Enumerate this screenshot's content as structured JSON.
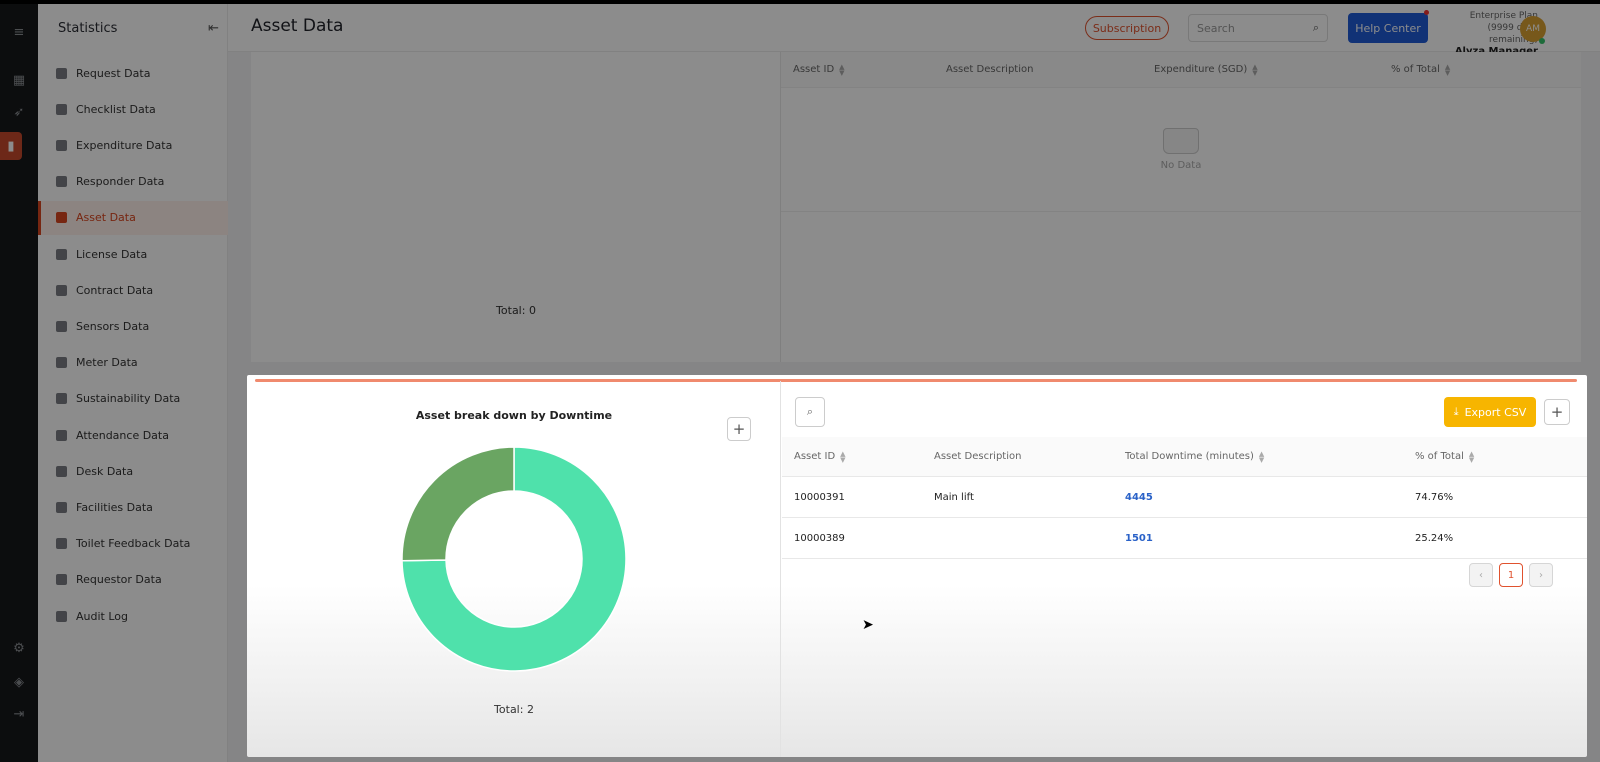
{
  "sidebar": {
    "title": "Statistics",
    "items": [
      {
        "label": "Request Data"
      },
      {
        "label": "Checklist Data"
      },
      {
        "label": "Expenditure Data"
      },
      {
        "label": "Responder Data"
      },
      {
        "label": "Asset Data"
      },
      {
        "label": "License Data"
      },
      {
        "label": "Contract Data"
      },
      {
        "label": "Sensors Data"
      },
      {
        "label": "Meter Data"
      },
      {
        "label": "Sustainability Data"
      },
      {
        "label": "Attendance Data"
      },
      {
        "label": "Desk Data"
      },
      {
        "label": "Facilities Data"
      },
      {
        "label": "Toilet Feedback Data"
      },
      {
        "label": "Requestor Data"
      },
      {
        "label": "Audit Log"
      }
    ],
    "active_label": "Asset Data"
  },
  "header": {
    "title": "Asset Data",
    "subscription_label": "Subscription",
    "search_placeholder": "Search",
    "help_label": "Help Center",
    "plan_name": "Enterprise Plan",
    "plan_remaining": "(9999 days remaining)",
    "user_name": "Alyza Manager",
    "avatar_initials": "AM"
  },
  "expenditure_panel": {
    "total": "Total: 0",
    "columns": [
      "Asset ID",
      "Asset Description",
      "Expenditure (SGD)",
      "% of Total"
    ],
    "empty_text": "No Data"
  },
  "downtime_modal": {
    "chart_title": "Asset break down by Downtime",
    "chart_total": "Total: 2",
    "export_label": "Export CSV",
    "columns": [
      "Asset ID",
      "Asset Description",
      "Total Downtime (minutes)",
      "% of Total"
    ],
    "rows": [
      {
        "id": "10000391",
        "desc": "Main lift",
        "downtime": "4445",
        "pct": "74.76%"
      },
      {
        "id": "10000389",
        "desc": "",
        "downtime": "1501",
        "pct": "25.24%"
      }
    ],
    "current_page": "1"
  },
  "chart_data": {
    "type": "pie",
    "labels": [
      "10000391",
      "10000389"
    ],
    "values": [
      4445,
      1501
    ],
    "colors": [
      "#4fe1ab",
      "#6aa562"
    ],
    "title": "Asset break down by Downtime"
  },
  "colors": {
    "accent": "#e0522e",
    "help_blue": "#1f5bd8",
    "export_yellow": "#f7b500",
    "link_blue": "#2a62c8"
  }
}
